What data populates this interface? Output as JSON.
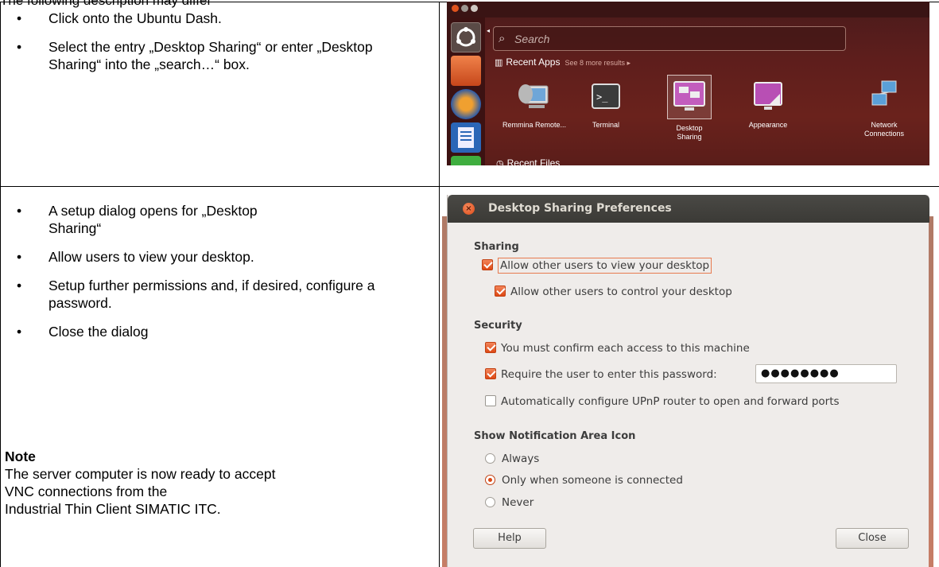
{
  "intro": "The following description may differ",
  "row1": {
    "bullets": [
      "Click onto the Ubuntu Dash.",
      "Select the entry „Desktop Sharing“ or enter „Desktop Sharing“ into the „search…“ box."
    ]
  },
  "dash": {
    "search_placeholder": "Search",
    "recent_apps_label": "Recent Apps",
    "more_results": "See 8 more results ▸",
    "apps": [
      {
        "label": "Remmina Remote...",
        "icon": "remote-desktop-icon"
      },
      {
        "label": "Terminal",
        "icon": "terminal-icon"
      },
      {
        "label": "Desktop Sharing",
        "icon": "desktop-sharing-icon"
      },
      {
        "label": "Appearance",
        "icon": "appearance-icon"
      },
      {
        "label": "Network Connections",
        "icon": "network-icon"
      }
    ],
    "recent_files_label": "Recent Files"
  },
  "row2": {
    "bullets": [
      "A setup dialog opens for „Desktop Sharing“",
      "Allow users to view your desktop.",
      "Setup further permissions and, if desired, configure a password.",
      "Close the dialog"
    ],
    "note_title": "Note",
    "note_lines": [
      "The server computer is now ready to accept",
      "VNC connections from the",
      "Industrial Thin Client SIMATIC ITC."
    ]
  },
  "dialog": {
    "title": "Desktop Sharing Preferences",
    "sharing_heading": "Sharing",
    "allow_view": "Allow other users to view your desktop",
    "allow_control": "Allow other users to control your desktop",
    "security_heading": "Security",
    "confirm_access": "You must confirm each access to this machine",
    "require_password": "Require the user to enter this password:",
    "password_value": "●●●●●●●●",
    "upnp": "Automatically configure UPnP router to open and forward ports",
    "notif_heading": "Show Notification Area Icon",
    "opt_always": "Always",
    "opt_connected": "Only when someone is connected",
    "opt_never": "Never",
    "help_button": "Help",
    "close_button": "Close"
  }
}
